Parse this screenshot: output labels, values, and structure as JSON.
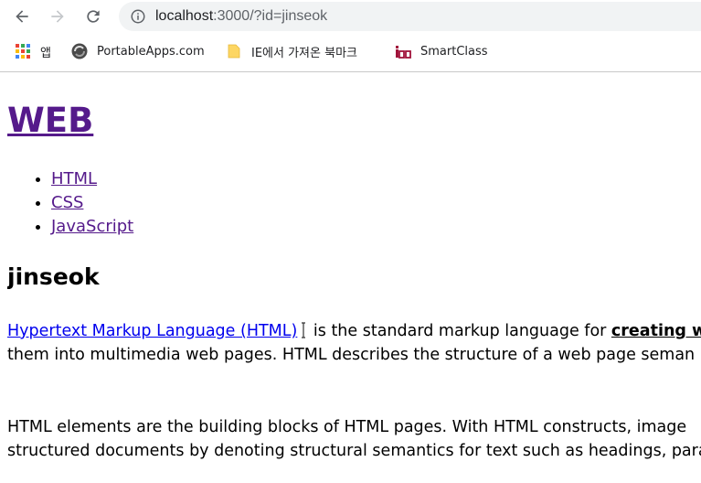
{
  "browser": {
    "url_host": "localhost",
    "url_path": ":3000/?id=jinseok",
    "bookmarks": [
      {
        "label": "앱",
        "icon": "apps-grid-icon"
      },
      {
        "label": "PortableApps.com",
        "icon": "portableapps-icon"
      },
      {
        "label": "IE에서 가져온 북마크",
        "icon": "folder-icon"
      },
      {
        "label": "SmartClass",
        "icon": "smartclass-logo-icon"
      }
    ]
  },
  "page": {
    "title": "WEB",
    "nav_items": [
      "HTML",
      "CSS",
      "JavaScript"
    ],
    "heading": "jinseok",
    "para1": {
      "link": "Hypertext Markup Language (HTML)",
      "text1": " is the standard markup language for ",
      "bold": "creating we",
      "line2": "them into multimedia web pages. HTML describes the structure of a web page seman"
    },
    "para2": {
      "line1": "HTML elements are the building blocks of HTML pages. With HTML constructs, image",
      "line2": "structured documents by denoting structural semantics for text such as headings, para"
    }
  }
}
